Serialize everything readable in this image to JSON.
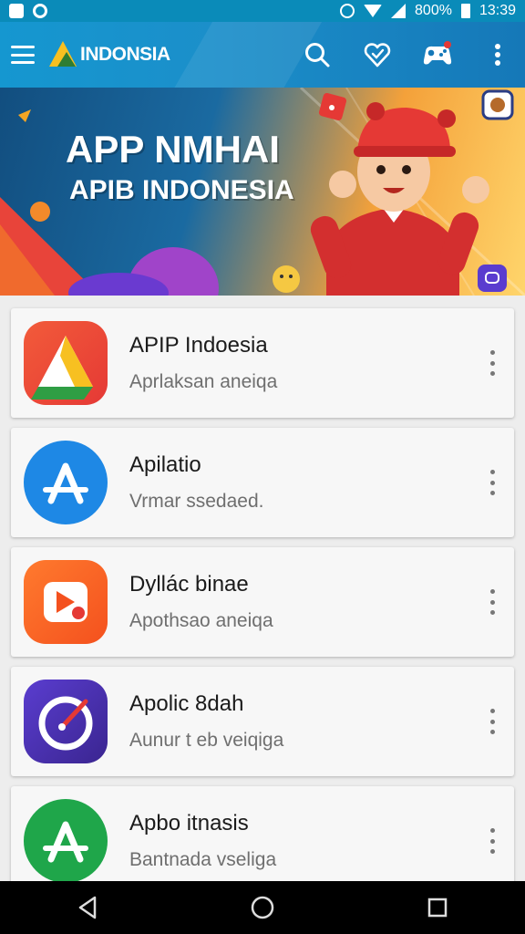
{
  "status_bar": {
    "battery": "800%",
    "time": "13:39"
  },
  "app_bar": {
    "brand": "INDONSIA",
    "icons": [
      "menu-icon",
      "search-icon",
      "heart-badge-icon",
      "gamepad-icon",
      "more-vert-icon"
    ],
    "colors": {
      "primary": "#1597d0",
      "badge": "#e53935"
    }
  },
  "banner": {
    "title": "APP NMHAI",
    "subtitle": "APIB INDONESIA"
  },
  "apps": [
    {
      "title": "APIP Indoesia",
      "subtitle": "Aprlaksan aneiqa",
      "icon": "play-triangle-icon",
      "color": "#e8442e"
    },
    {
      "title": "Apilatio",
      "subtitle": "Vrmar ssedaed.",
      "icon": "app-store-a-icon",
      "color": "#1e88e5"
    },
    {
      "title": "Dyllác binae",
      "subtitle": "Apothsao aneiqa",
      "icon": "media-play-icon",
      "color": "#f4511e"
    },
    {
      "title": "Apolic 8dah",
      "subtitle": "Aunur t eb veiqiga",
      "icon": "target-pen-icon",
      "color": "#4a2fb0"
    },
    {
      "title": "Apbo itnasis",
      "subtitle": "Bantnada vseliga",
      "icon": "green-a-icon",
      "color": "#1fa64a"
    }
  ],
  "nav_bar": {
    "icons": [
      "back-icon",
      "home-icon",
      "recents-icon"
    ]
  }
}
